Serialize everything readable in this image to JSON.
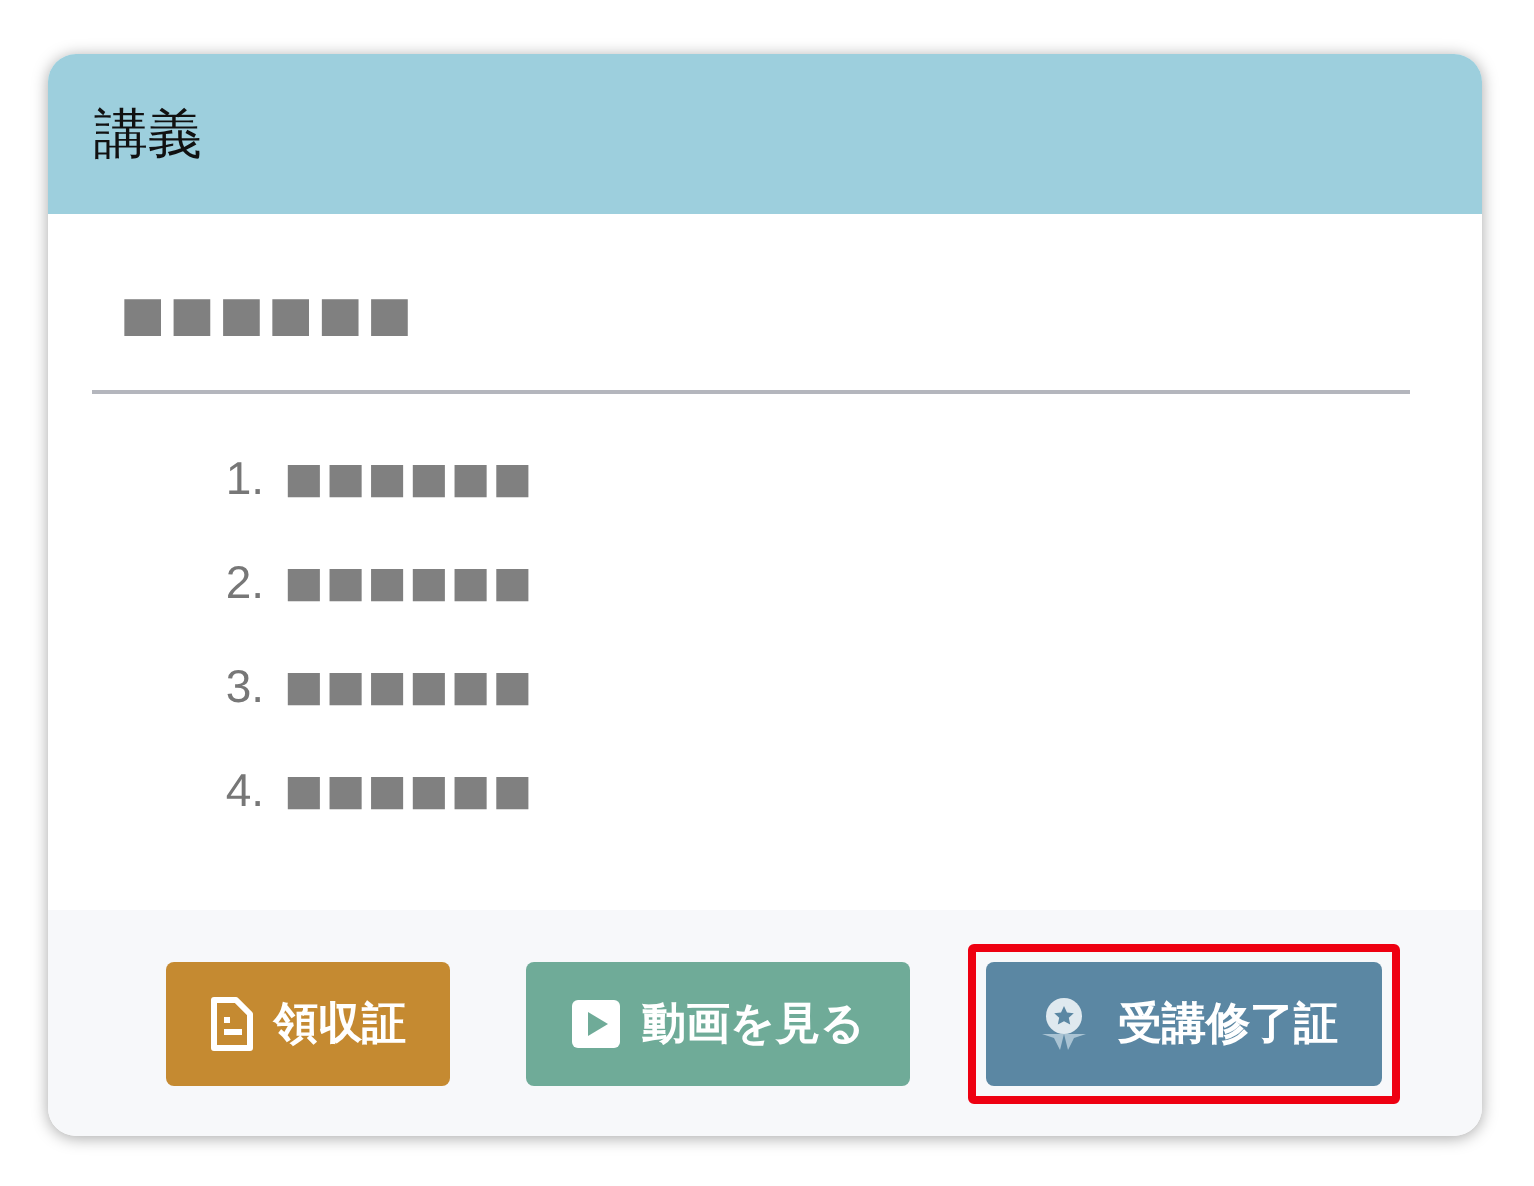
{
  "card": {
    "title": "講義"
  },
  "content": {
    "heading": "■■■■■■",
    "items": [
      {
        "number": "1.",
        "text": "■■■■■■"
      },
      {
        "number": "2.",
        "text": "■■■■■■"
      },
      {
        "number": "3.",
        "text": "■■■■■■"
      },
      {
        "number": "4.",
        "text": "■■■■■■"
      }
    ]
  },
  "buttons": [
    {
      "label": "領収証",
      "kind": "receipt",
      "color": "#c58a31",
      "highlighted": false
    },
    {
      "label": "動画を見る",
      "kind": "video",
      "color": "#6fab98",
      "highlighted": false
    },
    {
      "label": "受講修了証",
      "kind": "certificate",
      "color": "#5b87a3",
      "highlighted": true
    }
  ]
}
